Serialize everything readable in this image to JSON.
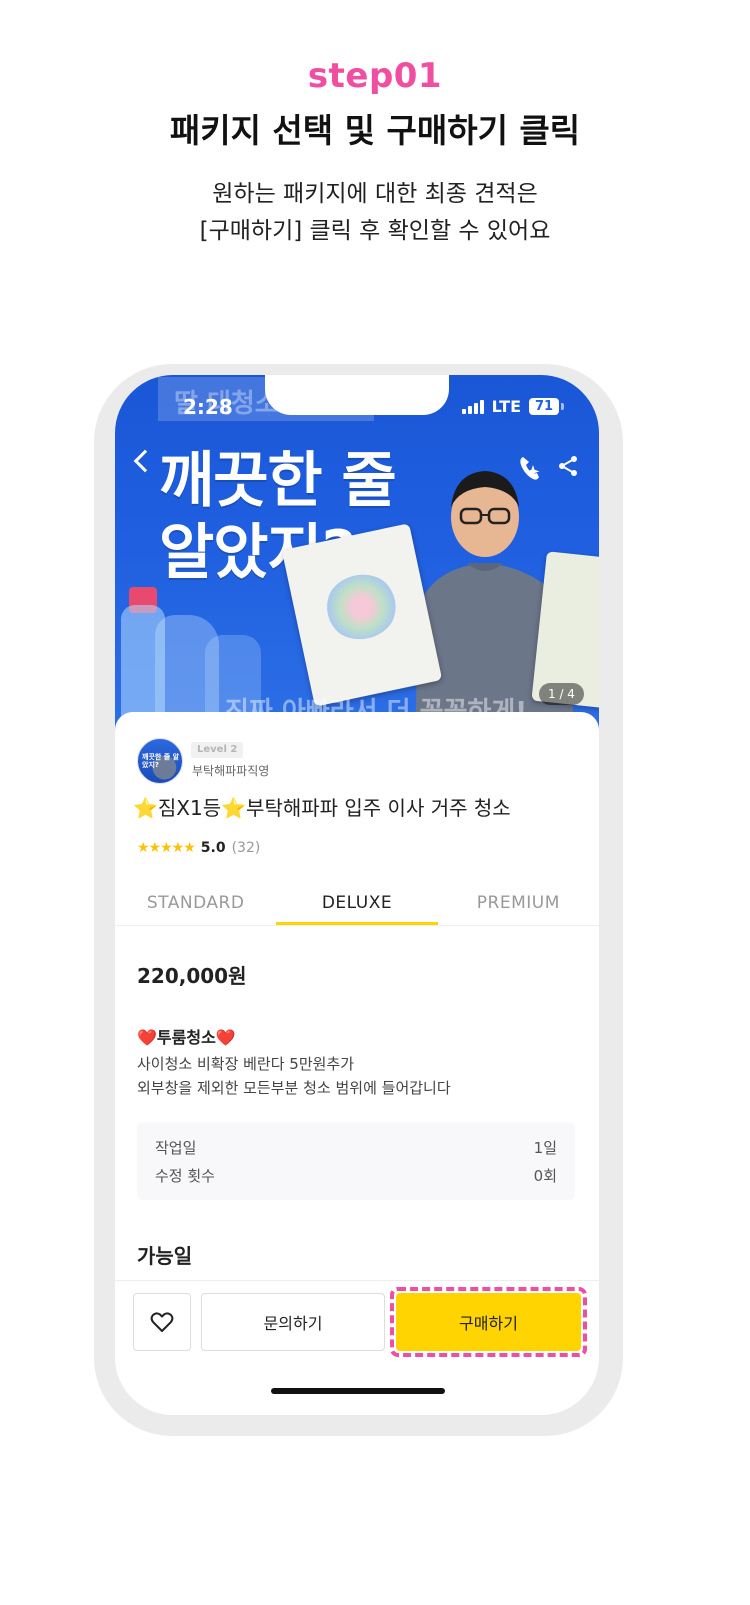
{
  "intro": {
    "step_label": "step01",
    "title": "패키지 선택 및 구매하기 클릭",
    "desc_line1": "원하는 패키지에 대한 최종 견적은",
    "desc_line2": "[구매하기] 클릭 후 확인할 수 있어요"
  },
  "status_bar": {
    "time": "2:28",
    "network": "LTE",
    "battery": "71"
  },
  "hero": {
    "tag": "딸 대청소",
    "headline_line1": "깨끗한 줄",
    "headline_line2": "알았지?",
    "footer_text": "진짜 아빠라서 더 꼼꼼하게!",
    "page_counter": "1 / 4"
  },
  "seller": {
    "level": "Level 2",
    "name": "부탁해파파직영",
    "avatar_text": "깨끗한 줄 알았지?"
  },
  "product": {
    "title_star": "⭐",
    "title_part1": "짐X1등",
    "title_part2": "부탁해파파 입주 이사 거주 청소",
    "stars": "★★★★★",
    "rating_score": "5.0",
    "rating_count": "(32)"
  },
  "tabs": [
    {
      "label": "STANDARD"
    },
    {
      "label": "DELUXE"
    },
    {
      "label": "PREMIUM"
    }
  ],
  "package": {
    "price": "220,000원",
    "heart": "❤️",
    "name": "투룸청소",
    "desc_line1": "사이청소 비확장 베란다 5만원추가",
    "desc_line2": "외부창을 제외한 모든부분 청소 범위에 들어갑니다",
    "specs": [
      {
        "label": "작업일",
        "value": "1일"
      },
      {
        "label": "수정 횟수",
        "value": "0회"
      }
    ],
    "availability_label": "가능일"
  },
  "actions": {
    "inquiry_label": "문의하기",
    "buy_label": "구매하기"
  },
  "colors": {
    "accent_pink": "#f04ea0",
    "buy_yellow": "#ffd400",
    "hero_blue": "#1f5fe0"
  }
}
